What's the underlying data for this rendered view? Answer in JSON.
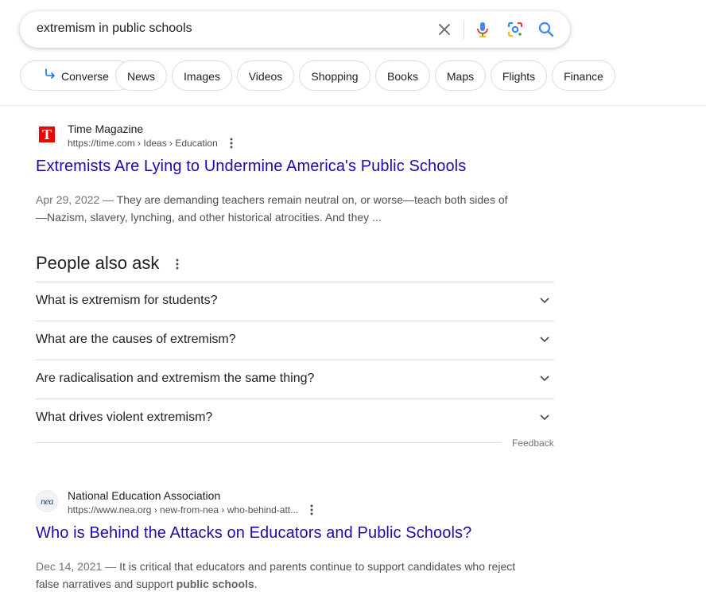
{
  "search": {
    "query": "extremism in public schools"
  },
  "chips": [
    {
      "label": "Converse"
    },
    {
      "label": "News"
    },
    {
      "label": "Images"
    },
    {
      "label": "Videos"
    },
    {
      "label": "Shopping"
    },
    {
      "label": "Books"
    },
    {
      "label": "Maps"
    },
    {
      "label": "Flights"
    },
    {
      "label": "Finance"
    }
  ],
  "results": [
    {
      "site_name": "Time Magazine",
      "url": "https://time.com › Ideas › Education",
      "favicon_text": "T",
      "title": "Extremists Are Lying to Undermine America's Public Schools",
      "date": "Apr 29, 2022 —",
      "snippet": "They are demanding teachers remain neutral on, or worse—teach both sides of —Nazism, slavery, lynching, and other historical atrocities. And they ..."
    },
    {
      "site_name": "National Education Association",
      "url": "https://www.nea.org › new-from-nea › who-behind-att...",
      "favicon_text": "nea",
      "title": "Who is Behind the Attacks on Educators and Public Schools?",
      "date": "Dec 14, 2021 —",
      "snippet_before": "It is critical that educators and parents continue to support candidates who reject false narratives and support",
      "snippet_bold": "public schools",
      "snippet_after": "."
    }
  ],
  "people_also_ask": {
    "title": "People also ask",
    "questions": [
      "What is extremism for students?",
      "What are the causes of extremism?",
      "Are radicalisation and extremism the same thing?",
      "What drives violent extremism?"
    ],
    "feedback_label": "Feedback"
  },
  "colors": {
    "link": "#1a0dab",
    "time_favicon": "#e90606",
    "nea_favicon": "#1b3a8a"
  },
  "icons": [
    "clear-icon",
    "microphone-icon",
    "lens-icon",
    "search-icon",
    "converse-arrow-icon",
    "more-options-icon",
    "chevron-down-icon"
  ]
}
